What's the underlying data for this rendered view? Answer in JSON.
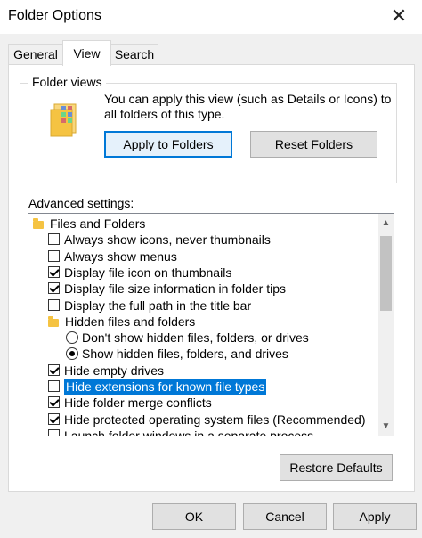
{
  "window": {
    "title": "Folder Options",
    "close_glyph": "✕"
  },
  "tabs": [
    {
      "label": "General",
      "active": false
    },
    {
      "label": "View",
      "active": true
    },
    {
      "label": "Search",
      "active": false
    }
  ],
  "folder_views": {
    "legend": "Folder views",
    "description_line1": "You can apply this view (such as Details or Icons) to",
    "description_line2": "all folders of this type.",
    "apply_button": "Apply to Folders",
    "reset_button": "Reset Folders"
  },
  "advanced": {
    "label": "Advanced settings:",
    "items": [
      {
        "kind": "folder",
        "indent": 0,
        "label": "Files and Folders"
      },
      {
        "kind": "checkbox",
        "indent": 1,
        "checked": false,
        "label": "Always show icons, never thumbnails"
      },
      {
        "kind": "checkbox",
        "indent": 1,
        "checked": false,
        "label": "Always show menus"
      },
      {
        "kind": "checkbox",
        "indent": 1,
        "checked": true,
        "label": "Display file icon on thumbnails"
      },
      {
        "kind": "checkbox",
        "indent": 1,
        "checked": true,
        "label": "Display file size information in folder tips"
      },
      {
        "kind": "checkbox",
        "indent": 1,
        "checked": false,
        "label": "Display the full path in the title bar"
      },
      {
        "kind": "folder",
        "indent": 1,
        "label": "Hidden files and folders"
      },
      {
        "kind": "radio",
        "indent": 2,
        "checked": false,
        "label": "Don't show hidden files, folders, or drives"
      },
      {
        "kind": "radio",
        "indent": 2,
        "checked": true,
        "label": "Show hidden files, folders, and drives"
      },
      {
        "kind": "checkbox",
        "indent": 1,
        "checked": true,
        "label": "Hide empty drives"
      },
      {
        "kind": "checkbox",
        "indent": 1,
        "checked": false,
        "label": "Hide extensions for known file types",
        "selected": true
      },
      {
        "kind": "checkbox",
        "indent": 1,
        "checked": true,
        "label": "Hide folder merge conflicts"
      },
      {
        "kind": "checkbox",
        "indent": 1,
        "checked": true,
        "label": "Hide protected operating system files (Recommended)"
      },
      {
        "kind": "checkbox",
        "indent": 1,
        "checked": false,
        "label": "Launch folder windows in a separate process"
      }
    ],
    "restore_button": "Restore Defaults"
  },
  "footer": {
    "ok": "OK",
    "cancel": "Cancel",
    "apply": "Apply"
  }
}
